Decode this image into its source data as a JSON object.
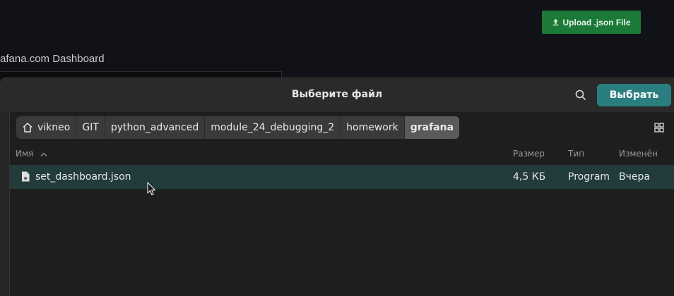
{
  "background": {
    "upload_button": "Upload .json File",
    "page_title": "afana.com Dashboard",
    "upload_icon": "upload-icon"
  },
  "dialog": {
    "title": "Выберите файл",
    "select_button": "Выбрать",
    "search_icon": "search-icon",
    "view_toggle_icon": "grid-view-icon",
    "path": [
      {
        "label": "vikneo",
        "icon": "home-icon",
        "active": false
      },
      {
        "label": "GIT",
        "active": false
      },
      {
        "label": "python_advanced",
        "active": false
      },
      {
        "label": "module_24_debugging_2",
        "active": false
      },
      {
        "label": "homework",
        "active": false
      },
      {
        "label": "grafana",
        "active": true
      }
    ],
    "columns": {
      "name": "Имя",
      "size": "Размер",
      "type": "Тип",
      "modified": "Изменён"
    },
    "files": [
      {
        "name": "set_dashboard.json",
        "size": "4,5 КБ",
        "type": "Program",
        "modified": "Вчера",
        "icon": "json-file-icon",
        "selected": true
      }
    ]
  },
  "colors": {
    "accent": "#2b7e80",
    "upload_green": "#1b7a37",
    "selection": "#223b3b"
  }
}
